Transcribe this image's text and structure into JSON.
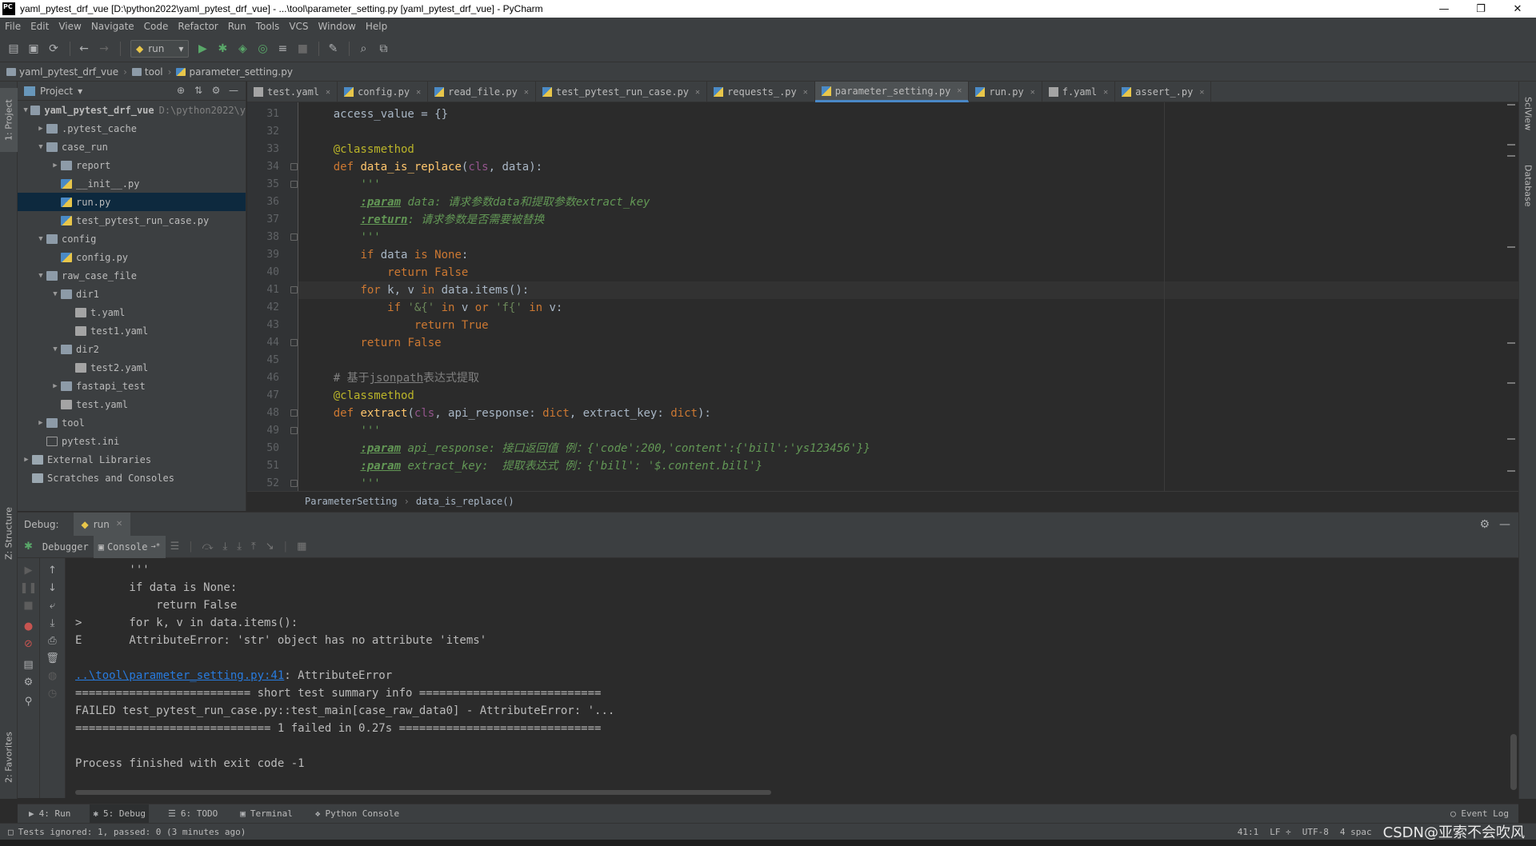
{
  "window": {
    "title": "yaml_pytest_drf_vue [D:\\python2022\\yaml_pytest_drf_vue] - ...\\tool\\parameter_setting.py [yaml_pytest_drf_vue] - PyCharm",
    "app_icon": "PC",
    "controls": {
      "minimize": "—",
      "maximize": "❐",
      "close": "✕"
    }
  },
  "menu": [
    "File",
    "Edit",
    "View",
    "Navigate",
    "Code",
    "Refactor",
    "Run",
    "Tools",
    "VCS",
    "Window",
    "Help"
  ],
  "toolbar": {
    "run_config": "run",
    "icons": [
      "open-icon",
      "save-icon",
      "sync-icon",
      "back-icon",
      "forward-icon",
      "run-icon",
      "debug-icon",
      "coverage-icon",
      "profile-icon",
      "concurrency-icon",
      "stop-icon",
      "settings-icon",
      "search-icon",
      "structure-icon"
    ]
  },
  "navbar": {
    "crumbs": [
      "yaml_pytest_drf_vue",
      "tool",
      "parameter_setting.py"
    ]
  },
  "left_stripe": {
    "project": "1: Project",
    "structure": "Z: Structure",
    "favorites": "2: Favorites"
  },
  "right_stripe": {
    "sciview": "SciView",
    "database": "Database"
  },
  "project_panel": {
    "title": "Project",
    "tree": [
      {
        "label": "yaml_pytest_drf_vue",
        "hint": "D:\\python2022\\y",
        "depth": 0,
        "type": "folder",
        "arrow": "▼",
        "bold": true
      },
      {
        "label": ".pytest_cache",
        "depth": 1,
        "type": "folder",
        "arrow": "▶"
      },
      {
        "label": "case_run",
        "depth": 1,
        "type": "folder",
        "arrow": "▼"
      },
      {
        "label": "report",
        "depth": 2,
        "type": "folder",
        "arrow": "▶"
      },
      {
        "label": "__init__.py",
        "depth": 2,
        "type": "py",
        "arrow": ""
      },
      {
        "label": "run.py",
        "depth": 2,
        "type": "py",
        "arrow": "",
        "selected": true
      },
      {
        "label": "test_pytest_run_case.py",
        "depth": 2,
        "type": "py",
        "arrow": ""
      },
      {
        "label": "config",
        "depth": 1,
        "type": "folder",
        "arrow": "▼"
      },
      {
        "label": "config.py",
        "depth": 2,
        "type": "py",
        "arrow": ""
      },
      {
        "label": "raw_case_file",
        "depth": 1,
        "type": "folder",
        "arrow": "▼"
      },
      {
        "label": "dir1",
        "depth": 2,
        "type": "folder",
        "arrow": "▼"
      },
      {
        "label": "t.yaml",
        "depth": 3,
        "type": "yaml",
        "arrow": ""
      },
      {
        "label": "test1.yaml",
        "depth": 3,
        "type": "yaml",
        "arrow": ""
      },
      {
        "label": "dir2",
        "depth": 2,
        "type": "folder",
        "arrow": "▼"
      },
      {
        "label": "test2.yaml",
        "depth": 3,
        "type": "yaml",
        "arrow": ""
      },
      {
        "label": "fastapi_test",
        "depth": 2,
        "type": "folder",
        "arrow": "▶"
      },
      {
        "label": "test.yaml",
        "depth": 2,
        "type": "yaml",
        "arrow": ""
      },
      {
        "label": "tool",
        "depth": 1,
        "type": "folder",
        "arrow": "▶"
      },
      {
        "label": "pytest.ini",
        "depth": 1,
        "type": "ini",
        "arrow": ""
      },
      {
        "label": "External Libraries",
        "depth": 0,
        "type": "lib",
        "arrow": "▶"
      },
      {
        "label": "Scratches and Consoles",
        "depth": 0,
        "type": "lib",
        "arrow": ""
      }
    ]
  },
  "tabs": [
    {
      "label": "test.yaml",
      "type": "yaml"
    },
    {
      "label": "config.py",
      "type": "py"
    },
    {
      "label": "read_file.py",
      "type": "py"
    },
    {
      "label": "test_pytest_run_case.py",
      "type": "py"
    },
    {
      "label": "requests_.py",
      "type": "py"
    },
    {
      "label": "parameter_setting.py",
      "type": "py",
      "active": true
    },
    {
      "label": "run.py",
      "type": "py"
    },
    {
      "label": "f.yaml",
      "type": "yaml"
    },
    {
      "label": "assert_.py",
      "type": "py"
    }
  ],
  "editor": {
    "current_line": "41",
    "lines": [
      {
        "n": "31",
        "html": "    access_value = {}"
      },
      {
        "n": "32",
        "html": ""
      },
      {
        "n": "33",
        "html": "    <span class='dec'>@classmethod</span>"
      },
      {
        "n": "34",
        "html": "    <span class='kw'>def</span> <span class='fn'>data_is_replace</span>(<span class='self'>cls</span>, data):"
      },
      {
        "n": "35",
        "html": "        <span class='doc'>'''</span>"
      },
      {
        "n": "36",
        "html": "        <span class='doctag'>:param</span><span class='doc'> data: 请求参数data和提取参数extract_key</span>"
      },
      {
        "n": "37",
        "html": "        <span class='doctag'>:return</span><span class='doc'>: 请求参数是否需要被替换</span>"
      },
      {
        "n": "38",
        "html": "        <span class='doc'>'''</span>"
      },
      {
        "n": "39",
        "html": "        <span class='kw'>if</span> data <span class='kw'>is None</span>:"
      },
      {
        "n": "40",
        "html": "            <span class='kw'>return False</span>"
      },
      {
        "n": "41",
        "html": "        <span class='kw'>for</span> k, v <span class='kw'>in</span> data.items():"
      },
      {
        "n": "42",
        "html": "            <span class='kw'>if</span> <span class='str'>'&amp;{'</span> <span class='kw'>in</span> v <span class='kw'>or</span> <span class='str'>'f{'</span> <span class='kw'>in</span> v:"
      },
      {
        "n": "43",
        "html": "                <span class='kw'>return True</span>"
      },
      {
        "n": "44",
        "html": "        <span class='kw'>return False</span>"
      },
      {
        "n": "45",
        "html": ""
      },
      {
        "n": "46",
        "html": "    <span class='cmt'># 基于<u>jsonpath</u>表达式提取</span>"
      },
      {
        "n": "47",
        "html": "    <span class='dec'>@classmethod</span>"
      },
      {
        "n": "48",
        "html": "    <span class='kw'>def</span> <span class='fn'>extract</span>(<span class='self'>cls</span>, api_response: <span class='kw'>dict</span>, extract_key: <span class='kw'>dict</span>):"
      },
      {
        "n": "49",
        "html": "        <span class='doc'>'''</span>"
      },
      {
        "n": "50",
        "html": "        <span class='doctag'>:param</span><span class='doc'> api_response: 接口返回值 例：{'code':200,'content':{'bill':'ys123456'}}</span>"
      },
      {
        "n": "51",
        "html": "        <span class='doctag'>:param</span><span class='doc'> extract_key:  提取表达式 例：{'bill': '$.content.bill'}</span>"
      },
      {
        "n": "52",
        "html": "        <span class='doc'>'''</span>"
      }
    ],
    "breadcrumb": [
      "ParameterSetting",
      "data_is_replace()"
    ]
  },
  "debug": {
    "label": "Debug:",
    "run_tab": "run",
    "tabs": {
      "debugger": "Debugger",
      "console": "Console"
    },
    "console_lines": [
      "        '''",
      "        if data is None:",
      "            return False",
      ">       for k, v in data.items():",
      "E       AttributeError: 'str' object has no attribute 'items'",
      "",
      "LINK",
      "========================== short test summary info ===========================",
      "FAILED test_pytest_run_case.py::test_main[case_raw_data0] - AttributeError: '...",
      "============================= 1 failed in 0.27s ==============================",
      "",
      "Process finished with exit code -1"
    ],
    "link_text": "..\\tool\\parameter_setting.py:41",
    "link_suffix": ": AttributeError"
  },
  "bottom_tabs": [
    {
      "label": "4: Run",
      "icon": "▶"
    },
    {
      "label": "5: Debug",
      "icon": "✱",
      "active": true
    },
    {
      "label": "6: TODO",
      "icon": "☰"
    },
    {
      "label": "Terminal",
      "icon": "▣"
    },
    {
      "label": "Python Console",
      "icon": "❖"
    }
  ],
  "event_log": "Event Log",
  "status": {
    "message": "Tests ignored: 1, passed: 0 (3 minutes ago)",
    "position": "41:1",
    "line_sep": "LF ÷",
    "encoding": "UTF-8",
    "indent": "4 spac",
    "watermark": "CSDN@亚索不会吹风"
  }
}
